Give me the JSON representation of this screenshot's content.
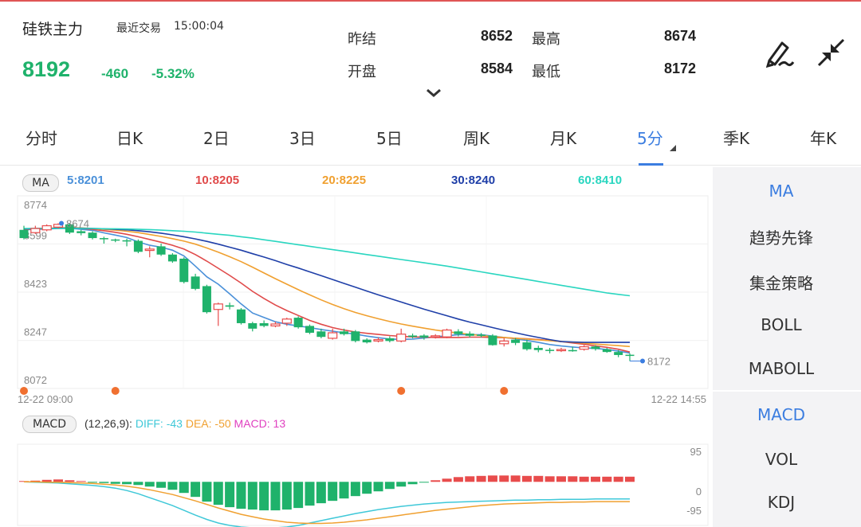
{
  "header": {
    "name": "硅铁主力",
    "trade_label": "最近交易",
    "trade_time": "15:00:04",
    "price": "8192",
    "change": "-460",
    "change_pct": "-5.32%",
    "stats": [
      {
        "label": "昨结",
        "value": "8652"
      },
      {
        "label": "开盘",
        "value": "8584"
      },
      {
        "label": "最高",
        "value": "8674"
      },
      {
        "label": "最低",
        "value": "8172"
      }
    ],
    "down_color": "#1fb26b",
    "up_color": "#e84c4c"
  },
  "tabs": [
    "分时",
    "日K",
    "2日",
    "3日",
    "5日",
    "周K",
    "月K",
    "5分",
    "季K",
    "年K"
  ],
  "active_tab": "5分",
  "ma_legend": {
    "pill": "MA",
    "items": [
      {
        "text": "5:8201",
        "color": "#4a90d9"
      },
      {
        "text": "10:8205",
        "color": "#e04a4a"
      },
      {
        "text": "20:8225",
        "color": "#f0a030"
      },
      {
        "text": "30:8240",
        "color": "#1f3fa8"
      },
      {
        "text": "60:8410",
        "color": "#2ad6c0"
      }
    ]
  },
  "macd_legend": {
    "pill": "MACD",
    "params": "(12,26,9):",
    "diff": "DIFF: -43",
    "dea": "DEA: -50",
    "macd": "MACD: 13",
    "diff_color": "#3fc8d8",
    "dea_color": "#f0a030",
    "macd_color": "#e040c0"
  },
  "side_menu_top": [
    "MA",
    "趋势先锋",
    "集金策略",
    "BOLL",
    "MABOLL"
  ],
  "side_menu_bottom": [
    "MACD",
    "VOL",
    "KDJ"
  ],
  "chart_data": [
    {
      "type": "candlestick",
      "title": "",
      "ylim": [
        8072,
        8774
      ],
      "y_ticks": [
        "8774",
        "8599",
        "8423",
        "8247",
        "8072"
      ],
      "x_start_label": "12-22 09:00",
      "x_end_label": "12-22 14:55",
      "high_marker": "8674",
      "low_marker": "8172",
      "candles": [
        {
          "o": 8650,
          "c": 8620,
          "h": 8665,
          "l": 8615
        },
        {
          "o": 8640,
          "c": 8655,
          "h": 8665,
          "l": 8635
        },
        {
          "o": 8650,
          "c": 8665,
          "h": 8670,
          "l": 8645
        },
        {
          "o": 8660,
          "c": 8670,
          "h": 8674,
          "l": 8655
        },
        {
          "o": 8670,
          "c": 8640,
          "h": 8674,
          "l": 8635
        },
        {
          "o": 8645,
          "c": 8638,
          "h": 8650,
          "l": 8630
        },
        {
          "o": 8640,
          "c": 8620,
          "h": 8645,
          "l": 8615
        },
        {
          "o": 8620,
          "c": 8618,
          "h": 8625,
          "l": 8600
        },
        {
          "o": 8615,
          "c": 8613,
          "h": 8618,
          "l": 8605
        },
        {
          "o": 8612,
          "c": 8611,
          "h": 8618,
          "l": 8590
        },
        {
          "o": 8610,
          "c": 8570,
          "h": 8615,
          "l": 8565
        },
        {
          "o": 8575,
          "c": 8580,
          "h": 8590,
          "l": 8550
        },
        {
          "o": 8590,
          "c": 8560,
          "h": 8600,
          "l": 8555
        },
        {
          "o": 8560,
          "c": 8535,
          "h": 8565,
          "l": 8530
        },
        {
          "o": 8545,
          "c": 8460,
          "h": 8550,
          "l": 8455
        },
        {
          "o": 8480,
          "c": 8435,
          "h": 8490,
          "l": 8430
        },
        {
          "o": 8445,
          "c": 8350,
          "h": 8450,
          "l": 8345
        },
        {
          "o": 8360,
          "c": 8380,
          "h": 8385,
          "l": 8300
        },
        {
          "o": 8375,
          "c": 8370,
          "h": 8385,
          "l": 8360
        },
        {
          "o": 8360,
          "c": 8310,
          "h": 8365,
          "l": 8305
        },
        {
          "o": 8310,
          "c": 8290,
          "h": 8315,
          "l": 8280
        },
        {
          "o": 8310,
          "c": 8300,
          "h": 8320,
          "l": 8295
        },
        {
          "o": 8300,
          "c": 8307,
          "h": 8315,
          "l": 8295
        },
        {
          "o": 8310,
          "c": 8325,
          "h": 8330,
          "l": 8300
        },
        {
          "o": 8330,
          "c": 8295,
          "h": 8335,
          "l": 8290
        },
        {
          "o": 8300,
          "c": 8275,
          "h": 8305,
          "l": 8270
        },
        {
          "o": 8280,
          "c": 8260,
          "h": 8290,
          "l": 8255
        },
        {
          "o": 8255,
          "c": 8275,
          "h": 8290,
          "l": 8250
        },
        {
          "o": 8280,
          "c": 8270,
          "h": 8290,
          "l": 8265
        },
        {
          "o": 8280,
          "c": 8245,
          "h": 8285,
          "l": 8240
        },
        {
          "o": 8250,
          "c": 8240,
          "h": 8255,
          "l": 8236
        },
        {
          "o": 8245,
          "c": 8250,
          "h": 8258,
          "l": 8240
        },
        {
          "o": 8255,
          "c": 8245,
          "h": 8262,
          "l": 8240
        },
        {
          "o": 8245,
          "c": 8270,
          "h": 8290,
          "l": 8240
        },
        {
          "o": 8265,
          "c": 8260,
          "h": 8272,
          "l": 8255
        },
        {
          "o": 8265,
          "c": 8258,
          "h": 8270,
          "l": 8250
        },
        {
          "o": 8260,
          "c": 8264,
          "h": 8270,
          "l": 8254
        },
        {
          "o": 8260,
          "c": 8285,
          "h": 8290,
          "l": 8255
        },
        {
          "o": 8280,
          "c": 8270,
          "h": 8288,
          "l": 8262
        },
        {
          "o": 8272,
          "c": 8264,
          "h": 8280,
          "l": 8258
        },
        {
          "o": 8268,
          "c": 8266,
          "h": 8274,
          "l": 8258
        },
        {
          "o": 8265,
          "c": 8230,
          "h": 8270,
          "l": 8228
        },
        {
          "o": 8235,
          "c": 8245,
          "h": 8255,
          "l": 8225
        },
        {
          "o": 8250,
          "c": 8238,
          "h": 8256,
          "l": 8230
        },
        {
          "o": 8240,
          "c": 8215,
          "h": 8250,
          "l": 8210
        },
        {
          "o": 8220,
          "c": 8212,
          "h": 8228,
          "l": 8204
        },
        {
          "o": 8213,
          "c": 8210,
          "h": 8220,
          "l": 8200
        },
        {
          "o": 8210,
          "c": 8214,
          "h": 8220,
          "l": 8205
        },
        {
          "o": 8212,
          "c": 8211,
          "h": 8224,
          "l": 8206
        },
        {
          "o": 8215,
          "c": 8224,
          "h": 8230,
          "l": 8210
        },
        {
          "o": 8225,
          "c": 8216,
          "h": 8230,
          "l": 8210
        },
        {
          "o": 8215,
          "c": 8205,
          "h": 8220,
          "l": 8202
        },
        {
          "o": 8205,
          "c": 8194,
          "h": 8212,
          "l": 8186
        },
        {
          "o": 8195,
          "c": 8192,
          "h": 8200,
          "l": 8172
        }
      ],
      "series": [
        {
          "name": "MA5",
          "values": [
            8650,
            8652,
            8653,
            8655,
            8656,
            8652,
            8648,
            8639,
            8631,
            8622,
            8606,
            8594,
            8587,
            8576,
            8555,
            8518,
            8479,
            8452,
            8417,
            8380,
            8347,
            8331,
            8315,
            8306,
            8300,
            8294,
            8287,
            8281,
            8275,
            8270,
            8263,
            8257,
            8252,
            8251,
            8252,
            8256,
            8260,
            8264,
            8268,
            8268,
            8268,
            8263,
            8258,
            8253,
            8247,
            8240,
            8232,
            8227,
            8223,
            8220,
            8218,
            8214,
            8208,
            8201
          ]
        },
        {
          "name": "MA10",
          "values": [
            8652,
            8654,
            8655,
            8657,
            8658,
            8655,
            8652,
            8647,
            8641,
            8634,
            8625,
            8615,
            8605,
            8594,
            8580,
            8560,
            8536,
            8510,
            8484,
            8456,
            8426,
            8400,
            8376,
            8356,
            8338,
            8320,
            8306,
            8294,
            8285,
            8278,
            8273,
            8269,
            8265,
            8262,
            8260,
            8259,
            8258,
            8258,
            8258,
            8259,
            8259,
            8258,
            8257,
            8255,
            8253,
            8250,
            8247,
            8243,
            8238,
            8233,
            8227,
            8222,
            8215,
            8205
          ]
        },
        {
          "name": "MA20",
          "values": [
            8654,
            8655,
            8656,
            8657,
            8658,
            8657,
            8655,
            8652,
            8649,
            8645,
            8640,
            8633,
            8626,
            8618,
            8609,
            8598,
            8584,
            8569,
            8552,
            8534,
            8514,
            8493,
            8472,
            8452,
            8432,
            8413,
            8395,
            8378,
            8363,
            8349,
            8337,
            8326,
            8316,
            8307,
            8299,
            8292,
            8285,
            8279,
            8274,
            8269,
            8265,
            8261,
            8258,
            8255,
            8252,
            8249,
            8246,
            8243,
            8240,
            8237,
            8234,
            8231,
            8228,
            8225
          ]
        },
        {
          "name": "MA30",
          "values": [
            8654,
            8655,
            8655,
            8656,
            8656,
            8656,
            8655,
            8654,
            8652,
            8650,
            8647,
            8643,
            8638,
            8632,
            8625,
            8617,
            8608,
            8598,
            8587,
            8576,
            8563,
            8551,
            8538,
            8524,
            8511,
            8497,
            8483,
            8469,
            8455,
            8441,
            8427,
            8413,
            8400,
            8387,
            8374,
            8361,
            8349,
            8337,
            8325,
            8314,
            8304,
            8294,
            8284,
            8275,
            8266,
            8258,
            8250,
            8243,
            8241,
            8240,
            8240,
            8240,
            8240,
            8240
          ]
        },
        {
          "name": "MA60",
          "values": [
            8655,
            8655,
            8655,
            8655,
            8655,
            8655,
            8655,
            8654,
            8654,
            8653,
            8652,
            8651,
            8649,
            8647,
            8645,
            8642,
            8638,
            8634,
            8630,
            8625,
            8620,
            8614,
            8608,
            8602,
            8596,
            8590,
            8584,
            8578,
            8572,
            8566,
            8560,
            8554,
            8548,
            8542,
            8536,
            8530,
            8524,
            8518,
            8511,
            8504,
            8497,
            8490,
            8483,
            8476,
            8469,
            8462,
            8455,
            8448,
            8441,
            8434,
            8427,
            8420,
            8415,
            8410
          ]
        }
      ],
      "markers_at_candle_index": [
        0,
        8,
        33,
        42
      ]
    },
    {
      "type": "bar",
      "title": "",
      "ylim": [
        -110,
        95
      ],
      "y_ticks": [
        "95",
        "0",
        "-95"
      ],
      "series": [
        {
          "name": "MACD",
          "values": [
            2,
            3,
            5,
            6,
            4,
            2,
            -1,
            -3,
            -5,
            -6,
            -8,
            -12,
            -15,
            -20,
            -28,
            -38,
            -50,
            -58,
            -64,
            -68,
            -70,
            -72,
            -72,
            -70,
            -66,
            -60,
            -54,
            -48,
            -42,
            -36,
            -30,
            -24,
            -18,
            -12,
            -6,
            -2,
            4,
            8,
            12,
            14,
            15,
            16,
            16,
            16,
            15,
            15,
            14,
            14,
            14,
            13,
            13,
            13,
            13,
            13
          ]
        },
        {
          "name": "DIFF",
          "values": [
            0,
            -1,
            -2,
            -3,
            -5,
            -7,
            -9,
            -12,
            -16,
            -22,
            -30,
            -40,
            -50,
            -60,
            -72,
            -84,
            -95,
            -104,
            -110,
            -114,
            -116,
            -117,
            -116,
            -114,
            -110,
            -104,
            -98,
            -92,
            -86,
            -80,
            -75,
            -70,
            -66,
            -62,
            -59,
            -56,
            -54,
            -52,
            -51,
            -50,
            -49,
            -48,
            -47,
            -46,
            -46,
            -45,
            -45,
            -44,
            -44,
            -44,
            -43,
            -43,
            -43,
            -43
          ]
        },
        {
          "name": "DEA",
          "values": [
            0,
            0,
            -1,
            -1,
            -2,
            -3,
            -4,
            -6,
            -8,
            -11,
            -15,
            -20,
            -26,
            -32,
            -40,
            -48,
            -57,
            -66,
            -74,
            -82,
            -88,
            -94,
            -98,
            -102,
            -104,
            -105,
            -105,
            -104,
            -102,
            -99,
            -96,
            -92,
            -88,
            -84,
            -80,
            -76,
            -72,
            -69,
            -66,
            -63,
            -60,
            -58,
            -56,
            -55,
            -54,
            -53,
            -52,
            -52,
            -51,
            -51,
            -50,
            -50,
            -50,
            -50
          ]
        }
      ]
    }
  ]
}
